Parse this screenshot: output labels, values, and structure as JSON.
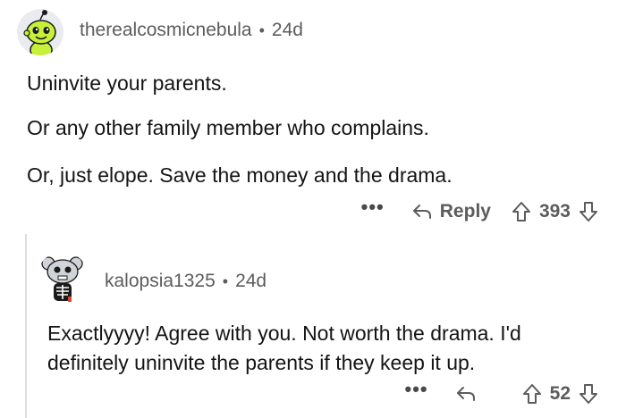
{
  "comment": {
    "author": "therealcosmicnebula",
    "separator": "•",
    "age": "24d",
    "paragraphs": [
      "Uninvite your parents.",
      "Or any other family member who complains.",
      "Or, just elope. Save the money and the drama."
    ],
    "more_label": "•••",
    "reply_label": "Reply",
    "score": "393"
  },
  "reply": {
    "author": "kalopsia1325",
    "separator": "•",
    "age": "24d",
    "lines": [
      "Exactlyyyy! Agree with you. Not worth the drama. I'd",
      "definitely uninvite the parents if they keep it up."
    ],
    "more_label": "•••",
    "score": "52"
  },
  "icons": {
    "reply": "reply-arrow-icon",
    "upvote": "upvote-arrow-icon",
    "downvote": "downvote-arrow-icon",
    "more": "more-dots-icon"
  }
}
